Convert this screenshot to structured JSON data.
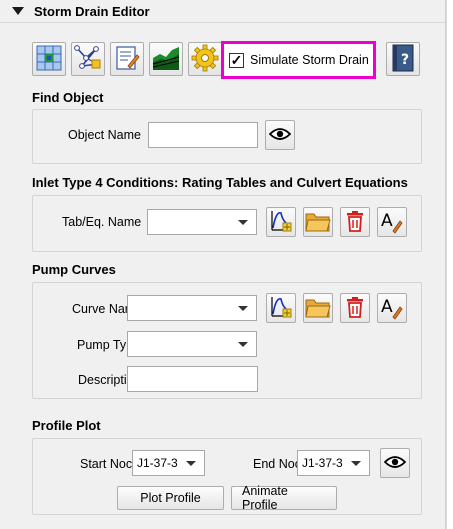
{
  "header": {
    "title": "Storm Drain Editor"
  },
  "toolbar": {
    "icons": [
      "grid-element-icon",
      "network-node-icon",
      "edit-form-icon",
      "terrain-profile-icon",
      "settings-gear-icon",
      "help-book-icon"
    ],
    "simulate_label": "Simulate Storm Drain",
    "simulate_checked": true
  },
  "find_object": {
    "title": "Find Object",
    "name_label": "Object Name",
    "name_value": ""
  },
  "inlet": {
    "title": "Inlet Type 4 Conditions: Rating Tables and Culvert Equations",
    "name_label": "Tab/Eq. Name",
    "name_value": ""
  },
  "pump": {
    "title": "Pump Curves",
    "curve_label": "Curve Nar",
    "curve_value": "",
    "type_label": "Pump Ty",
    "type_value": "",
    "desc_label": "Descripti",
    "desc_value": "",
    "a_glyph": "A"
  },
  "profile": {
    "title": "Profile Plot",
    "start_label": "Start Noc",
    "start_value": "J1-37-3",
    "end_label": "End Noc",
    "end_value": "J1-37-3",
    "plot_button": "Plot Profile",
    "animate_button": "Animate Profile"
  },
  "colors": {
    "accent_border": "#ee00cc",
    "delete_red": "#d22020",
    "folder_orange": "#f0b040"
  }
}
